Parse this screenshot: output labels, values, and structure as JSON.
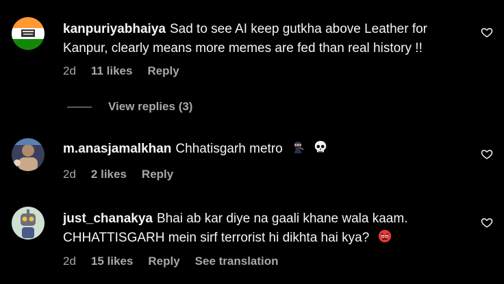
{
  "comments": [
    {
      "username": "kanpuriyabhaiya",
      "text": "Sad to see AI keep gutkha above Leather for Kanpur, clearly means more memes are fed than real history !!",
      "time": "2d",
      "likes": "11 likes",
      "reply": "Reply",
      "avatar_icon": "india-flag-avatar"
    },
    {
      "username": "m.anasjamalkhan",
      "text": "Chhatisgarh metro",
      "emojis": [
        "ninja-emoji",
        "skull-emoji"
      ],
      "time": "2d",
      "likes": "2 likes",
      "reply": "Reply",
      "avatar_icon": "user-photo-avatar"
    },
    {
      "username": "just_chanakya",
      "text": "Bhai ab kar diye na gaali khane wala kaam. CHHATTISGARH mein sirf terrorist hi dikhta hai kya?",
      "emojis": [
        "angry-face-emoji"
      ],
      "time": "2d",
      "likes": "15 likes",
      "reply": "Reply",
      "see_translation": "See translation",
      "avatar_icon": "robot-avatar"
    }
  ],
  "view_replies": "View replies (3)",
  "colors": {
    "background": "#000000",
    "text": "#f5f5f5",
    "secondary": "#a8a8a8"
  }
}
